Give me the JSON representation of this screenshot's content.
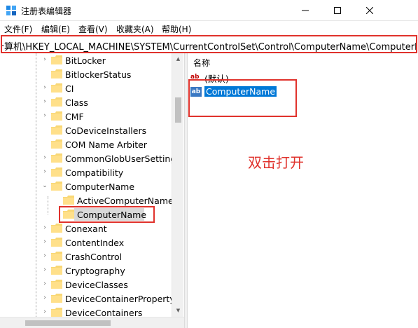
{
  "window": {
    "title": "注册表编辑器"
  },
  "menu": [
    "文件(F)",
    "编辑(E)",
    "查看(V)",
    "收藏夹(A)",
    "帮助(H)"
  ],
  "address": {
    "path": "计算机\\HKEY_LOCAL_MACHINE\\SYSTEM\\CurrentControlSet\\Control\\ComputerName\\ComputerName"
  },
  "tree": {
    "items": [
      {
        "label": "BitLocker",
        "expander": "›"
      },
      {
        "label": "BitlockerStatus",
        "expander": ""
      },
      {
        "label": "CI",
        "expander": "›"
      },
      {
        "label": "Class",
        "expander": "›"
      },
      {
        "label": "CMF",
        "expander": "›"
      },
      {
        "label": "CoDeviceInstallers",
        "expander": ""
      },
      {
        "label": "COM Name Arbiter",
        "expander": ""
      },
      {
        "label": "CommonGlobUserSettings",
        "expander": "›"
      },
      {
        "label": "Compatibility",
        "expander": "›"
      },
      {
        "label": "ComputerName",
        "expander": "⌄"
      },
      {
        "label": "ActiveComputerName",
        "expander": ""
      },
      {
        "label": "ComputerName",
        "expander": ""
      },
      {
        "label": "Conexant",
        "expander": "›"
      },
      {
        "label": "ContentIndex",
        "expander": "›"
      },
      {
        "label": "CrashControl",
        "expander": "›"
      },
      {
        "label": "Cryptography",
        "expander": "›"
      },
      {
        "label": "DeviceClasses",
        "expander": "›"
      },
      {
        "label": "DeviceContainerPropertyU",
        "expander": "›"
      },
      {
        "label": "DeviceContainers",
        "expander": "›"
      }
    ]
  },
  "values": {
    "column_name": "名称",
    "rows": [
      {
        "name": "(默认)",
        "icon": "ab"
      },
      {
        "name": "ComputerName",
        "icon": "ab"
      }
    ]
  },
  "annotation": {
    "text": "双击打开"
  },
  "colors": {
    "annotation_red": "#e0322c",
    "selection_blue": "#0078d7"
  }
}
